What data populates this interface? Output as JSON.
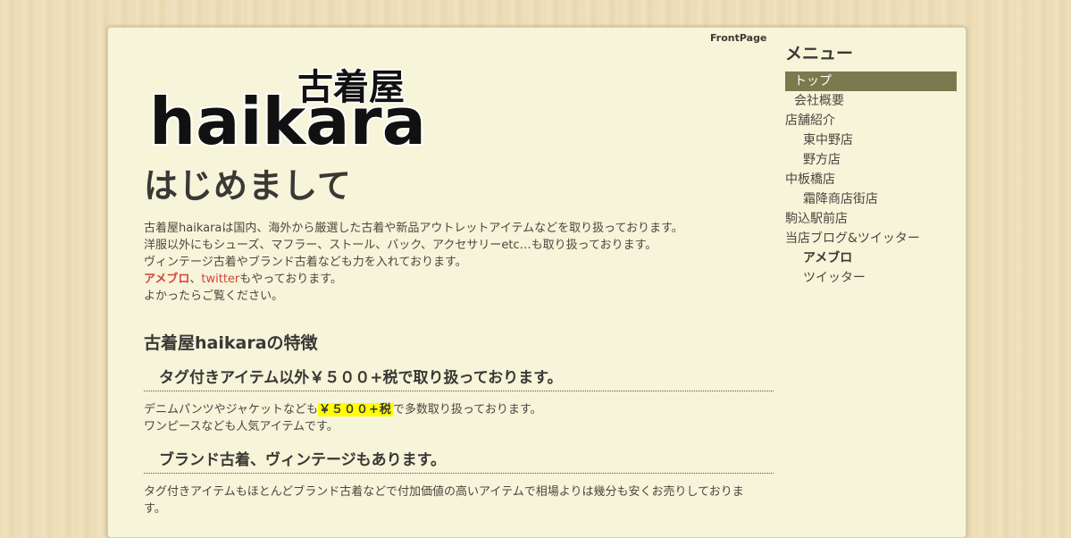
{
  "header": {
    "frontpage_link": "FrontPage"
  },
  "logo": {
    "top_text": "古着屋",
    "main_text": "haikara"
  },
  "main": {
    "title": "はじめまして",
    "intro": {
      "line1": "古着屋haikaraは国内、海外から厳選した古着や新品アウトレットアイテムなどを取り扱っております。",
      "line2": "洋服以外にもシューズ、マフラー、ストール、バック、アクセサリーetc…も取り扱っております。",
      "line3": "ヴィンテージ古着やブランド古着なども力を入れております。",
      "link_ameblo": "アメブロ",
      "sep": "、",
      "link_twitter": "twitter",
      "line4_rest": "もやっております。",
      "line5": "よかったらご覧ください。"
    },
    "features_title": "古着屋haikaraの特徴",
    "section1": {
      "heading": "タグ付きアイテム以外￥５００+税で取り扱っております。",
      "line1_pre": "デニムパンツやジャケットなども",
      "highlight": "￥５００+税",
      "line1_post": "で多数取り扱っております。",
      "line2": "ワンピースなども人気アイテムです。"
    },
    "section2": {
      "heading": "ブランド古着、ヴィンテージもあります。",
      "line1": "タグ付きアイテムもほとんどブランド古着などで付加価値の高いアイテムで相場よりは幾分も安くお売りしておりま",
      "line2": "す。"
    }
  },
  "menu": {
    "title": "メニュー",
    "items": [
      {
        "label": "トップ"
      },
      {
        "label": "会社概要"
      },
      {
        "label": "店舗紹介"
      },
      {
        "label": "東中野店"
      },
      {
        "label": "野方店"
      },
      {
        "label": "中板橋店"
      },
      {
        "label": "霜降商店街店"
      },
      {
        "label": "駒込駅前店"
      },
      {
        "label": "当店ブログ&ツイッター"
      },
      {
        "label": "アメブロ"
      },
      {
        "label": "ツイッター"
      }
    ]
  },
  "colors": {
    "page_bg": "#f6f4d9",
    "menu_active_bg": "#7a7a4e",
    "link": "#d9433d",
    "highlight": "#ffff00"
  }
}
